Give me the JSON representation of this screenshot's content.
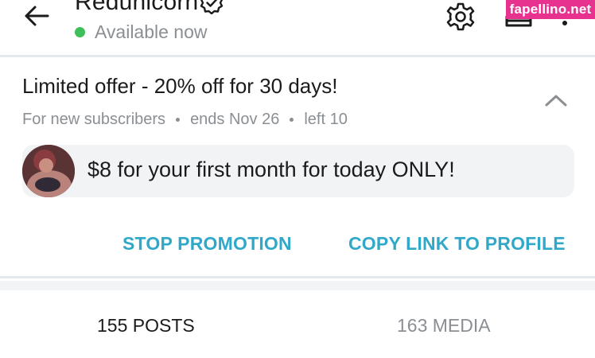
{
  "header": {
    "profile_name": "Redunicorn",
    "status": "Available now",
    "watermark": "fapellino.net"
  },
  "promo": {
    "title": "Limited offer - 20% off for 30 days!",
    "audience": "For new subscribers",
    "ends": "ends Nov 26",
    "left": "left 10",
    "offer_text": "$8 for your first month for today ONLY!",
    "stop_label": "STOP PROMOTION",
    "copy_label": "COPY LINK TO PROFILE"
  },
  "tabs": {
    "posts_label": "155 POSTS",
    "media_label": "163 MEDIA"
  },
  "colors": {
    "accent": "#2fa8c9",
    "online": "#3fbf59",
    "watermark_bg": "#e8328f"
  }
}
